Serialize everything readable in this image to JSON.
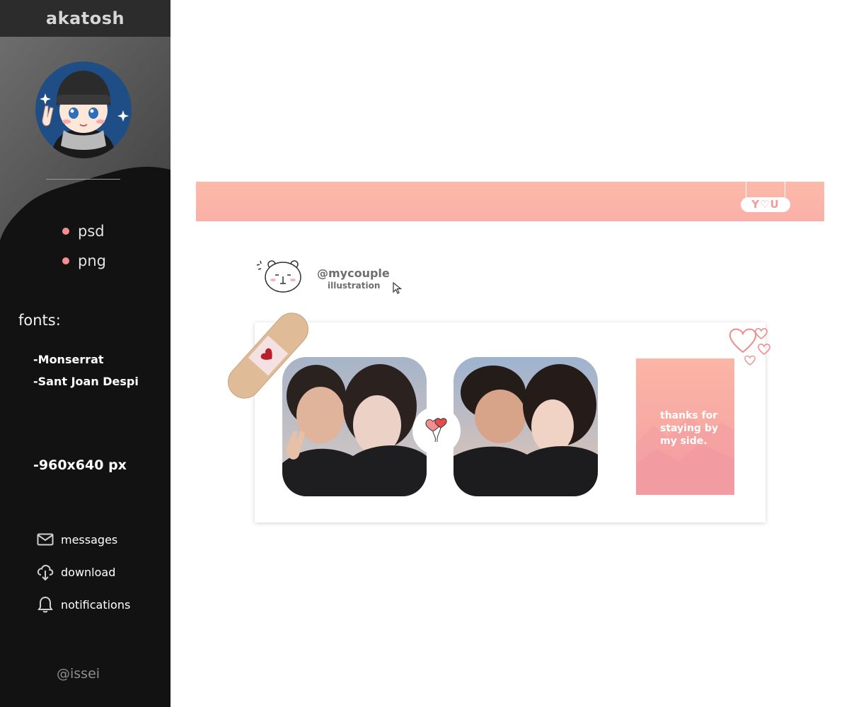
{
  "sidebar": {
    "title": "akatosh",
    "formats": [
      {
        "label": "psd"
      },
      {
        "label": "png"
      }
    ],
    "fonts_heading": "fonts:",
    "fonts": [
      "-Monserrat",
      "-Sant Joan Despi"
    ],
    "size": "-960x640 px",
    "menu": [
      {
        "label": "messages",
        "icon": "envelope-icon"
      },
      {
        "label": "download",
        "icon": "download-icon"
      },
      {
        "label": "notifications",
        "icon": "bell-icon"
      }
    ],
    "footer_handle": "@issei"
  },
  "banner": {
    "tag": "Y♡U"
  },
  "profile": {
    "handle": "@mycouple",
    "subtitle": "illustration"
  },
  "card": {
    "quote": "thanks for staying by my side."
  },
  "colors": {
    "sidebar_bg": "#121212",
    "header_bg": "#2c2c2c",
    "accent_pink": "#f58f8f",
    "banner_pink": "#fbb7a8"
  }
}
